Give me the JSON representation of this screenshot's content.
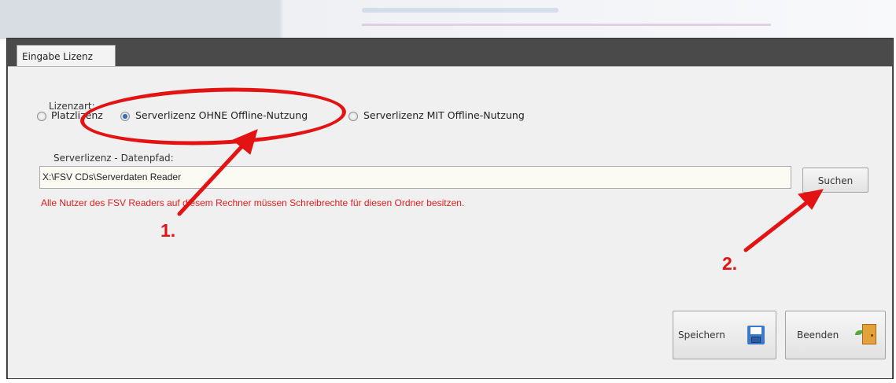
{
  "tab": {
    "label": "Eingabe Lizenz"
  },
  "license_type": {
    "heading": "Lizenzart:",
    "options": [
      {
        "label": "Platzlizenz",
        "selected": false
      },
      {
        "label": "Serverlizenz OHNE Offline-Nutzung",
        "selected": true
      },
      {
        "label": "Serverlizenz MIT Offline-Nutzung",
        "selected": false
      }
    ]
  },
  "server_path": {
    "label": "Serverlizenz - Datenpfad:",
    "value": "X:\\FSV CDs\\Serverdaten Reader",
    "search_button": "Suchen",
    "warning": "Alle Nutzer des FSV Readers auf diesem Rechner müssen Schreibrechte für diesen Ordner besitzen."
  },
  "buttons": {
    "save": "Speichern",
    "exit": "Beenden"
  },
  "annotations": {
    "step1": "1.",
    "step2": "2.",
    "color": "#e31313"
  },
  "icons": {
    "save": "floppy-disk-icon",
    "exit": "exit-door-icon"
  }
}
